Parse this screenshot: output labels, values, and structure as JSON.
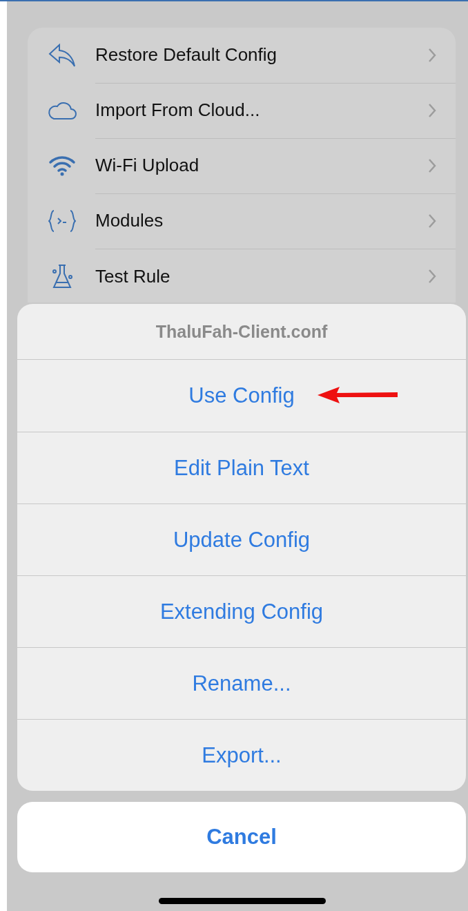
{
  "menu": {
    "items": [
      {
        "label": "Restore Default Config"
      },
      {
        "label": "Import From Cloud..."
      },
      {
        "label": "Wi-Fi Upload"
      },
      {
        "label": "Modules"
      },
      {
        "label": "Test Rule"
      }
    ]
  },
  "action_sheet": {
    "title": "ThaluFah-Client.conf",
    "actions": [
      {
        "label": "Use Config",
        "marked": true
      },
      {
        "label": "Edit Plain Text",
        "marked": false
      },
      {
        "label": "Update Config",
        "marked": false
      },
      {
        "label": "Extending Config",
        "marked": false
      },
      {
        "label": "Rename...",
        "marked": false
      },
      {
        "label": "Export...",
        "marked": false
      }
    ],
    "cancel": "Cancel"
  }
}
